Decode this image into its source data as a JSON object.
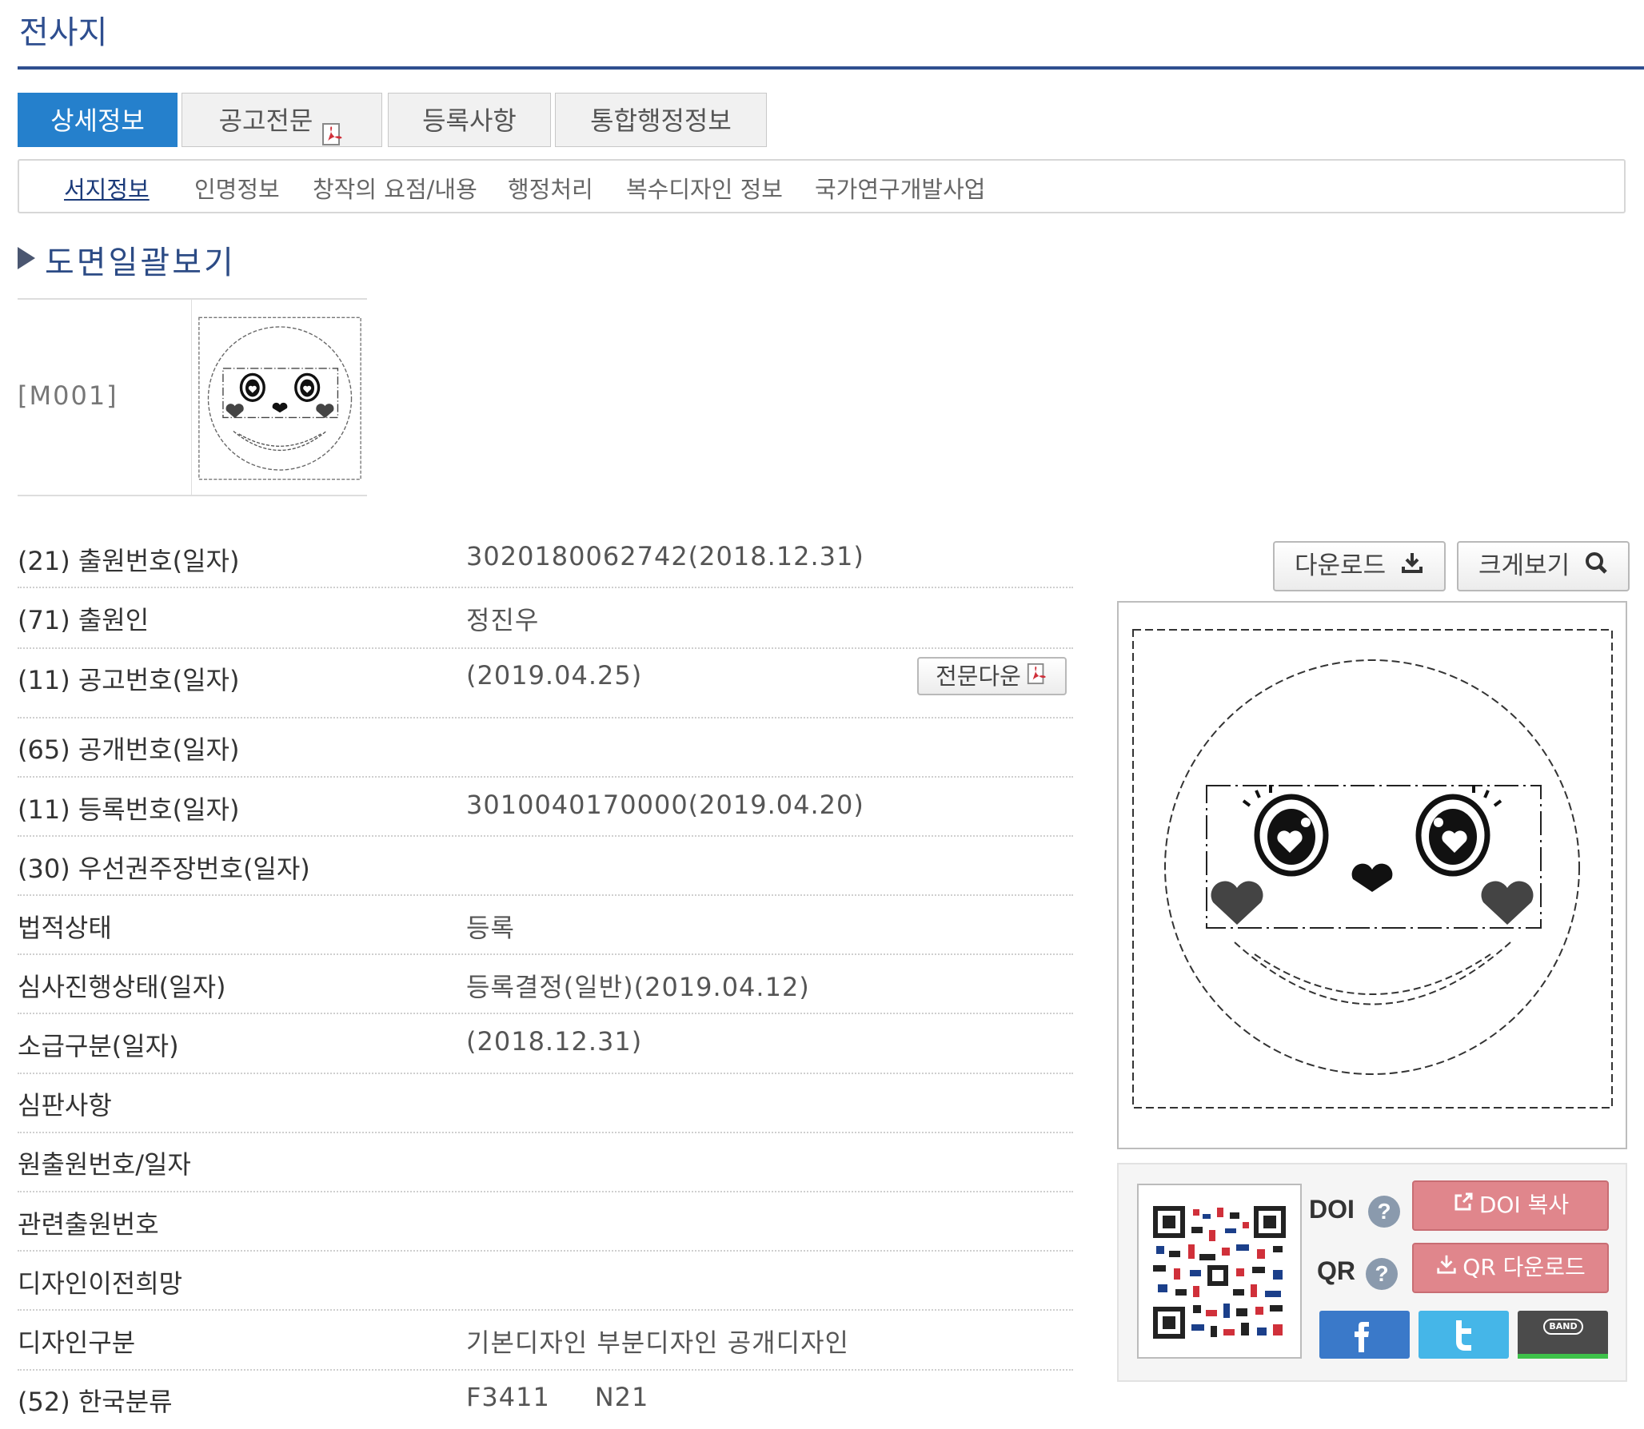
{
  "page": {
    "title": "전사지"
  },
  "tabs": [
    {
      "label": "상세정보",
      "active": true
    },
    {
      "label": "공고전문",
      "icon": "pdf-icon"
    },
    {
      "label": "등록사항"
    },
    {
      "label": "통합행정정보"
    }
  ],
  "subnav": [
    {
      "label": "서지정보",
      "active": true
    },
    {
      "label": "인명정보"
    },
    {
      "label": "창작의 요점/내용"
    },
    {
      "label": "행정처리"
    },
    {
      "label": "복수디자인 정보"
    },
    {
      "label": "국가연구개발사업"
    }
  ],
  "section": {
    "title": "도면일괄보기"
  },
  "drawings": [
    {
      "label": "[M001]"
    }
  ],
  "bib": {
    "rows": [
      {
        "label": "(21) 출원번호(일자)",
        "value": "3020180062742(2018.12.31)"
      },
      {
        "label": "(71) 출원인",
        "value": "정진우"
      },
      {
        "label": "(11) 공고번호(일자)",
        "value": "(2019.04.25)",
        "button": "전문다운"
      },
      {
        "label": "(65) 공개번호(일자)",
        "value": ""
      },
      {
        "label": "(11) 등록번호(일자)",
        "value": "3010040170000(2019.04.20)"
      },
      {
        "label": "(30) 우선권주장번호(일자)",
        "value": ""
      },
      {
        "label": "법적상태",
        "value": "등록"
      },
      {
        "label": "심사진행상태(일자)",
        "value": "등록결정(일반)(2019.04.12)"
      },
      {
        "label": "소급구분(일자)",
        "value": "(2018.12.31)"
      },
      {
        "label": "심판사항",
        "value": ""
      },
      {
        "label": "원출원번호/일자",
        "value": ""
      },
      {
        "label": "관련출원번호",
        "value": ""
      },
      {
        "label": "디자인이전희망",
        "value": ""
      },
      {
        "label": "디자인구분",
        "value": "기본디자인 부분디자인 공개디자인"
      },
      {
        "label": "(52) 한국분류",
        "value": "F3411     N21"
      }
    ]
  },
  "viewer": {
    "download_label": "다운로드",
    "zoom_label": "크게보기"
  },
  "share": {
    "doi_label": "DOI",
    "qr_label": "QR",
    "doi_copy_label": "DOI 복사",
    "qr_download_label": "QR 다운로드",
    "help_glyph": "?",
    "band_label": "BAND",
    "colors": {
      "facebook": "#3a79c9",
      "twitter": "#45b6e8",
      "band": "#4b4b4b",
      "pink": "#e0868c"
    }
  }
}
